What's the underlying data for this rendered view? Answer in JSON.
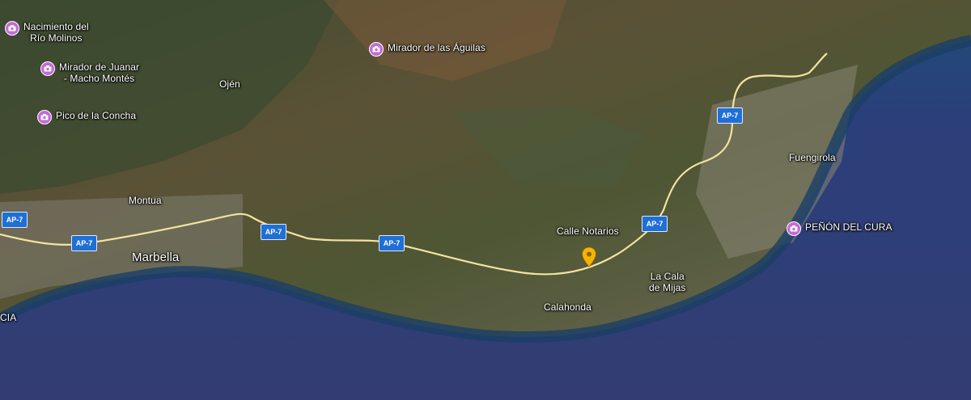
{
  "map": {
    "pois": [
      {
        "id": "nacimiento",
        "label": "Nacimiento del\nRío Molinos"
      },
      {
        "id": "mirador-juanar",
        "label": "Mirador de Juanar\n- Macho Montés"
      },
      {
        "id": "pico-concha",
        "label": "Pico de la Concha"
      },
      {
        "id": "mirador-aguilas",
        "label": "Mirador de las Águilas"
      },
      {
        "id": "penon-cura",
        "label": "PEÑÓN DEL CURA"
      }
    ],
    "places": {
      "ojen": "Ojén",
      "montua": "Montua",
      "marbella": "Marbella",
      "fuengirola": "Fuengirola",
      "calle_notarios": "Calle Notarios",
      "lacala": "La Cala\nde Mijas",
      "calahonda": "Calahonda",
      "edge": "CIA"
    },
    "highway": "AP-7",
    "colors": {
      "sea": "#2b3a6e",
      "road": "#f2e3a0",
      "poi": "#c46ad8",
      "shield": "#1f6fd6",
      "marker": "#f4b400"
    }
  }
}
